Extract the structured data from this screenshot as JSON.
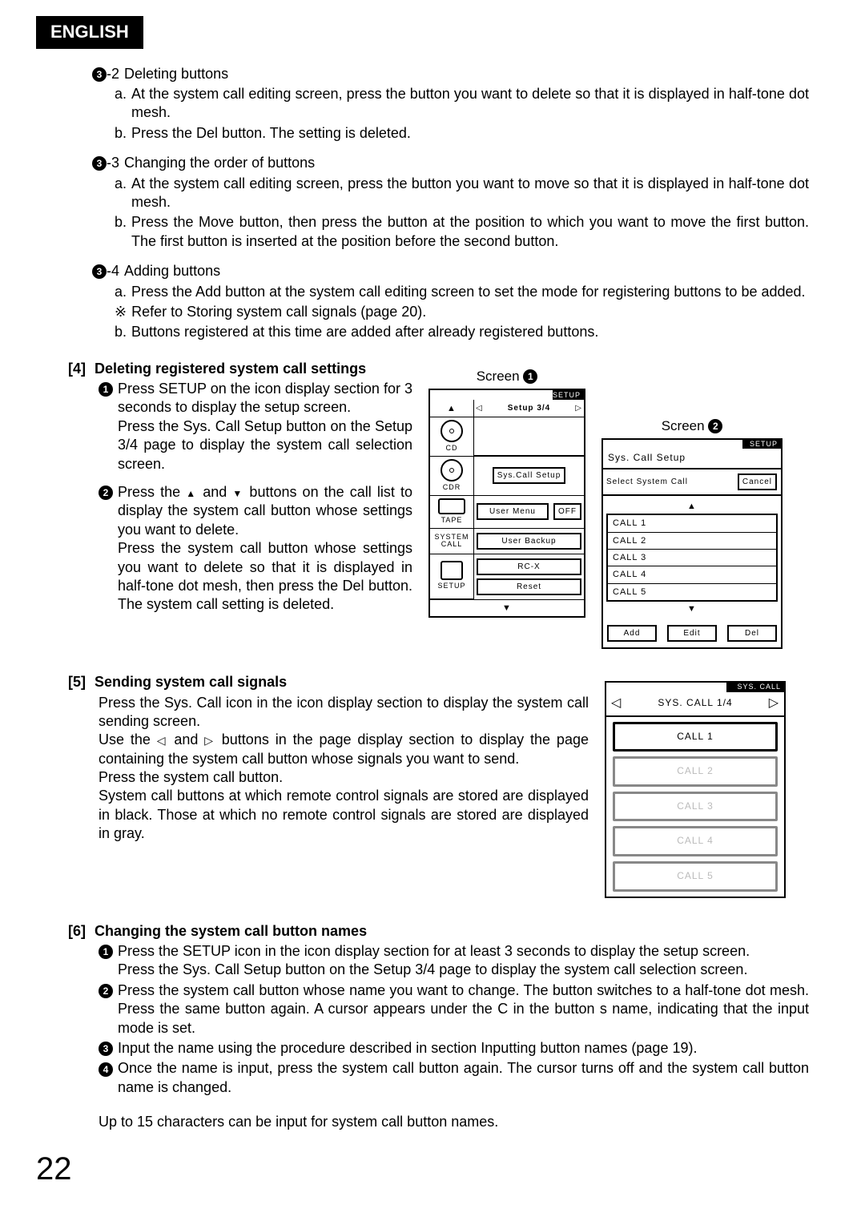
{
  "header_tab": "ENGLISH",
  "page_number": "22",
  "s32": {
    "bullet": "3",
    "suffix": "-2",
    "title": "Deleting buttons",
    "a": "a.",
    "a_txt": "At the system call editing screen, press the button you want to delete so that it is displayed in half-tone dot mesh.",
    "b": "b.",
    "b_txt": "Press the Del button. The setting is deleted."
  },
  "s33": {
    "bullet": "3",
    "suffix": "-3",
    "title": "Changing the order of buttons",
    "a": "a.",
    "a_txt": "At the system call editing screen, press the button you want to move so that it is displayed in half-tone dot mesh.",
    "b": "b.",
    "b_txt": "Press the Move button, then press the button at the position to which you want to move the first button. The first button is inserted at the position before the second button."
  },
  "s34": {
    "bullet": "3",
    "suffix": "-4",
    "title": "Adding buttons",
    "a": "a.",
    "a_txt": "Press the Add button at the system call editing screen to set the mode for registering buttons to be added.",
    "note_mark": "※",
    "note": "Refer to Storing system call signals (page 20).",
    "b": "b.",
    "b_txt": "Buttons registered at this time are added after already registered buttons."
  },
  "sec4": {
    "heading_num": "[4]",
    "heading": "Deleting registered system call settings",
    "n1": "1",
    "n1_txt": "Press SETUP on the icon display section for 3 seconds to display the setup screen.",
    "n1_txt2": "Press the Sys. Call Setup button on the Setup 3/4 page to display the system call selection screen.",
    "n2": "2",
    "n2_txt": "Press the ",
    "n2_txt_mid": " and ",
    "n2_txt_end": " buttons on the call list to display the system call button whose settings you want to delete.",
    "n2_txt2": "Press the system call button whose settings you want to delete so that it is displayed in half-tone dot mesh, then press the Del button. The system call setting is deleted."
  },
  "screen1": {
    "label": "Screen",
    "labnum": "1",
    "hdr": "SETUP",
    "nav": "Setup 3/4",
    "cd": "CD",
    "cdr": "CDR",
    "sys": "Sys.Call Setup",
    "tape": "TAPE",
    "usermenu": "User Menu",
    "off": "OFF",
    "syscall": "SYSTEM CALL",
    "userbackup": "User Backup",
    "setup": "SETUP",
    "rcx": "RC-X",
    "reset": "Reset"
  },
  "screen2": {
    "label": "Screen",
    "labnum": "2",
    "hdr": "SETUP",
    "title": "Sys. Call Setup",
    "subt": "Select System Call",
    "cancel": "Cancel",
    "rows": [
      "CALL  1",
      "CALL  2",
      "CALL  3",
      "CALL  4",
      "CALL  5"
    ],
    "add": "Add",
    "edit": "Edit",
    "del": "Del"
  },
  "sec5": {
    "heading_num": "[5]",
    "heading": "Sending system call signals",
    "p1": "Press the Sys. Call icon in the icon display section to display the system call sending screen.",
    "p2a": "Use the ",
    "p2b": " and ",
    "p2c": " buttons in the page display section to display the page containing the system call button whose signals you want to send.",
    "p3": "Press the system call button.",
    "p4": "System call buttons at which remote control signals are stored are displayed in black. Those at which no remote control signals are stored are displayed in gray."
  },
  "screen3": {
    "hdr": "SYS. CALL",
    "nav": "SYS. CALL  1/4",
    "rows": [
      "CALL  1",
      "CALL  2",
      "CALL  3",
      "CALL  4",
      "CALL  5"
    ]
  },
  "sec6": {
    "heading_num": "[6]",
    "heading": "Changing the system call button names",
    "n1": "1",
    "n1_txt": "Press the SETUP icon in the icon display section for at least 3 seconds to display the setup screen.",
    "n1_txt2": "Press the Sys. Call Setup button on the Setup 3/4 page to display the system call selection screen.",
    "n2": "2",
    "n2_txt": "Press the system call button whose name you want to change. The button switches to a half-tone dot mesh. Press the same button again. A cursor appears under the C in the button s name, indicating that the input mode is set.",
    "n3": "3",
    "n3_txt": "Input the name using the procedure described in section Inputting button names (page 19).",
    "n4": "4",
    "n4_txt": "Once the name is input, press the system call button again. The cursor turns off and the system call button name is changed.",
    "tail": "Up to 15 characters can be input for system call button names."
  }
}
